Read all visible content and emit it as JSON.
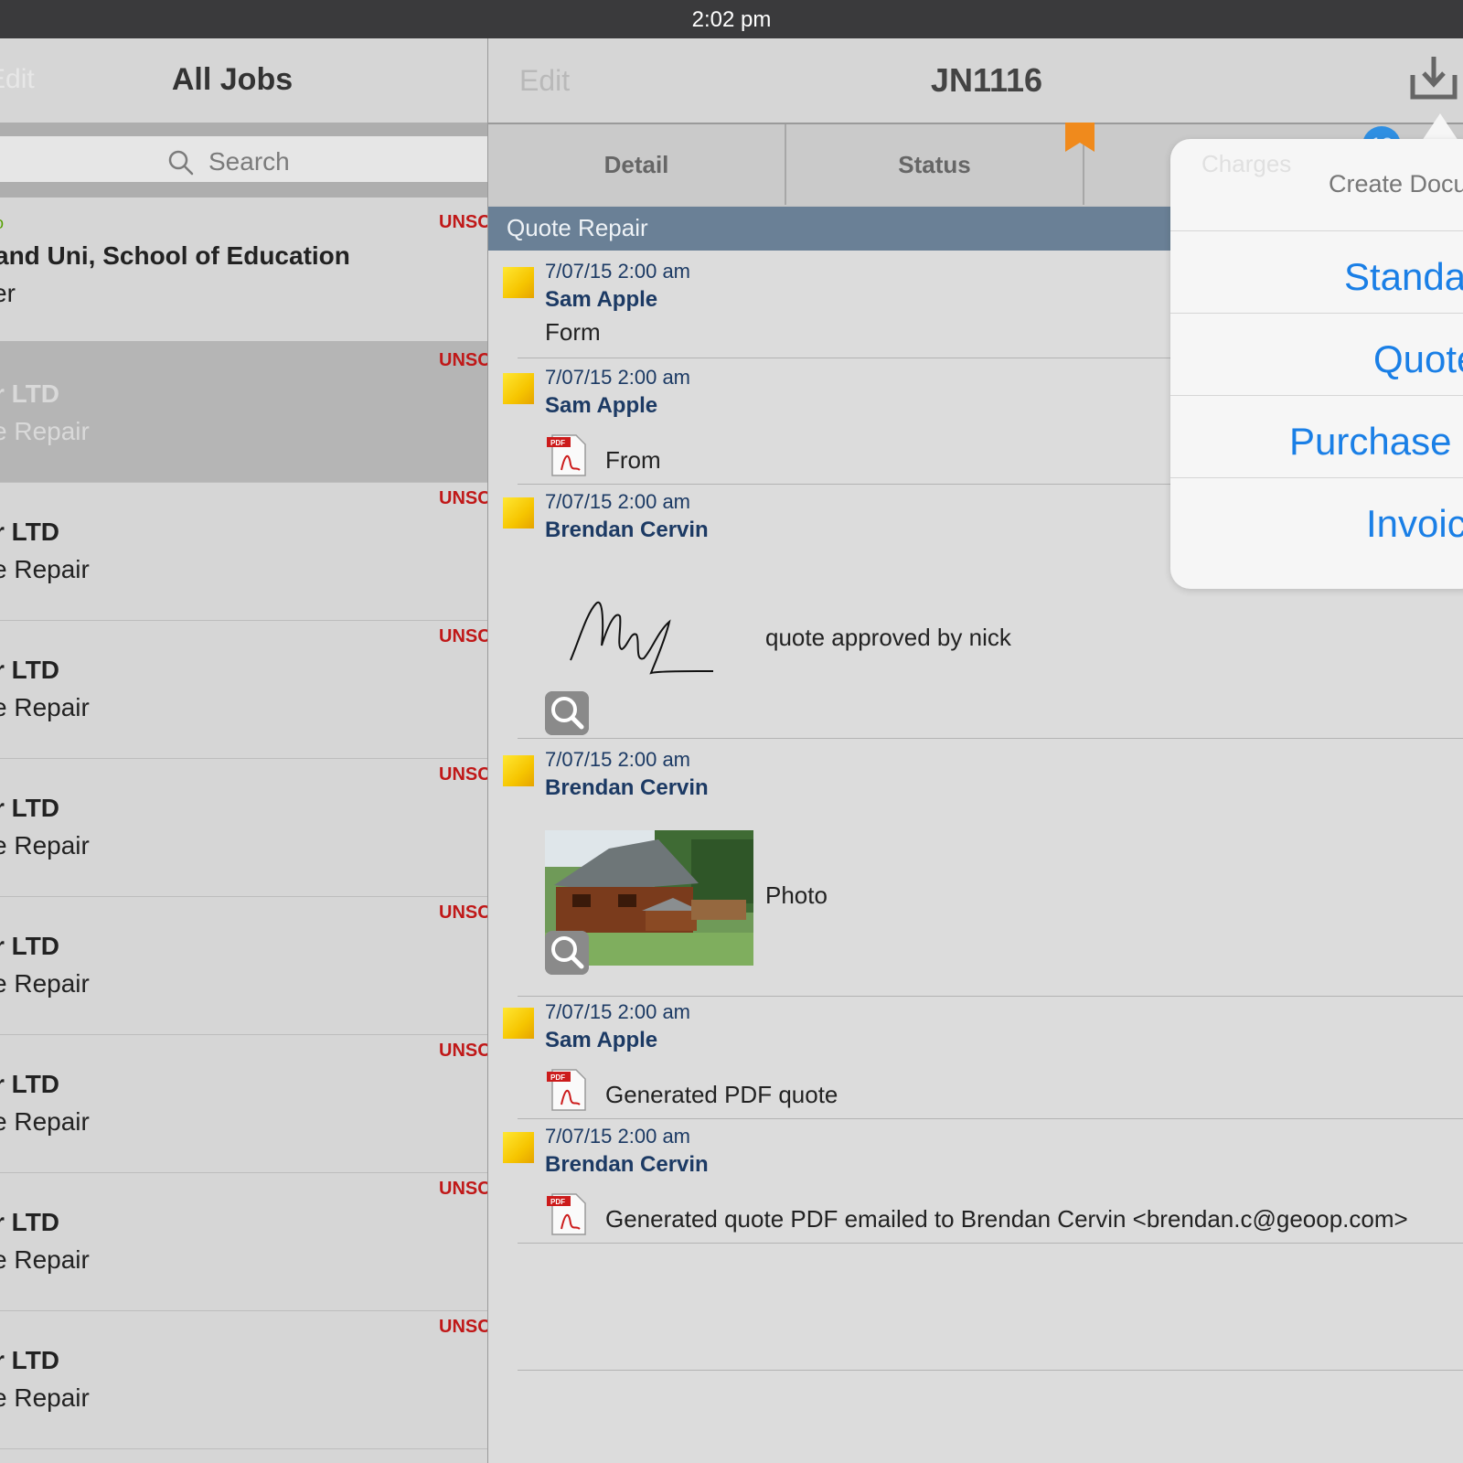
{
  "status_bar": {
    "time": "2:02 pm"
  },
  "left_pane": {
    "title": "All Jobs",
    "edit_label": "Edit",
    "search_placeholder": "Search",
    "jobs": [
      {
        "status": "UNSC",
        "tag": "o",
        "line1": "and Uni, School of Education",
        "line2": "er",
        "selected": false
      },
      {
        "status": "UNSC",
        "line1": "r LTD",
        "line2": "e Repair",
        "selected": true
      },
      {
        "status": "UNSC",
        "line1": "r LTD",
        "line2": "e Repair",
        "selected": false
      },
      {
        "status": "UNSC",
        "line1": "r LTD",
        "line2": "e Repair",
        "selected": false
      },
      {
        "status": "UNSC",
        "line1": "r LTD",
        "line2": "e Repair",
        "selected": false
      },
      {
        "status": "UNSC",
        "line1": "r LTD",
        "line2": "e Repair",
        "selected": false
      },
      {
        "status": "UNSC",
        "line1": "r LTD",
        "line2": "e Repair",
        "selected": false
      },
      {
        "status": "UNSC",
        "line1": "r LTD",
        "line2": "e Repair",
        "selected": false
      },
      {
        "status": "UNSC",
        "line1": "r LTD",
        "line2": "e Repair",
        "selected": false
      }
    ]
  },
  "detail": {
    "edit_label": "Edit",
    "title": "JN1116",
    "tabs": {
      "detail": "Detail",
      "status": "Status",
      "charges": "Charges"
    },
    "charges_badge": "12",
    "section_title": "Quote Repair",
    "entries": [
      {
        "date": "7/07/15 2:00 am",
        "author": "Sam Apple",
        "text": "Form",
        "attachment": "none"
      },
      {
        "date": "7/07/15 2:00 am",
        "author": "Sam Apple",
        "text": "From",
        "attachment": "pdf-icon"
      },
      {
        "date": "7/07/15 2:00 am",
        "author": "Brendan Cervin",
        "text": "quote approved by nick",
        "attachment": "signature"
      },
      {
        "date": "7/07/15 2:00 am",
        "author": "Brendan Cervin",
        "text": "Photo",
        "attachment": "photo"
      },
      {
        "date": "7/07/15 2:00 am",
        "author": "Sam Apple",
        "text": "Generated PDF quote",
        "attachment": "pdf-icon"
      },
      {
        "date": "7/07/15 2:00 am",
        "author": "Brendan Cervin",
        "text": "Generated quote PDF emailed to Brendan Cervin <brendan.c@geoop.com>",
        "attachment": "pdf-icon"
      }
    ]
  },
  "popover": {
    "title": "Create Docu",
    "items": [
      "Standa",
      "Quote",
      "Purchase",
      "Invoic"
    ]
  },
  "colors": {
    "accent": "#1a7fe6",
    "status_red": "#c01818",
    "section_header": "#6a8096",
    "author": "#1c3a64"
  }
}
